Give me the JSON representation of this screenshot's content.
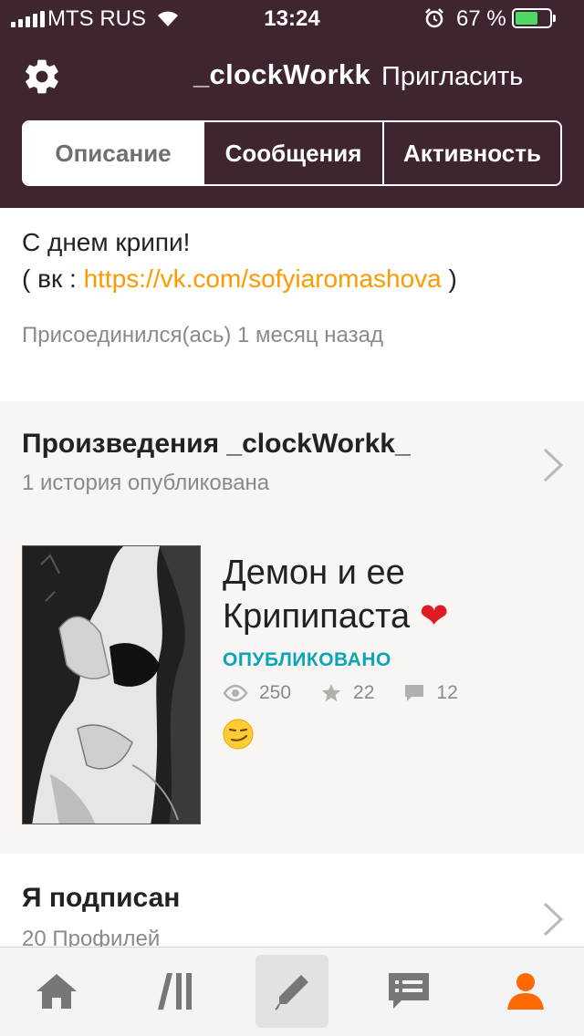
{
  "status_bar": {
    "carrier": "MTS RUS",
    "time": "13:24",
    "battery": "67 %",
    "battery_level": 0.67
  },
  "header": {
    "username": "_clockWorkk",
    "invite_label": "Пригласить"
  },
  "tabs": [
    {
      "label": "Описание",
      "active": true
    },
    {
      "label": "Сообщения",
      "active": false
    },
    {
      "label": "Активность",
      "active": false
    }
  ],
  "description": {
    "line1": "С днем крипи!",
    "prefix": "( вк : ",
    "link": "https://vk.com/sofyiaromashova",
    "suffix": " )",
    "joined": "Присоединился(ась) 1 месяц назад"
  },
  "works": {
    "title": "Произведения _clockWorkk_",
    "subtitle": "1 история опубликована",
    "story": {
      "title_line1": "Демон и ее",
      "title_line2": "Крипипаста",
      "status": "ОПУБЛИКОВАНО",
      "views": "250",
      "votes": "22",
      "comments": "12"
    }
  },
  "following": {
    "title": "Я подписан",
    "subtitle": "20 Профилей"
  },
  "bottom_nav": [
    {
      "icon": "home-icon"
    },
    {
      "icon": "library-icon"
    },
    {
      "icon": "pencil-icon"
    },
    {
      "icon": "messages-icon"
    },
    {
      "icon": "profile-icon"
    }
  ],
  "colors": {
    "header_bg": "#3f2530",
    "accent_orange": "#ff9900",
    "published_teal": "#0ba5ba",
    "works_bg": "#f8f5f2"
  }
}
